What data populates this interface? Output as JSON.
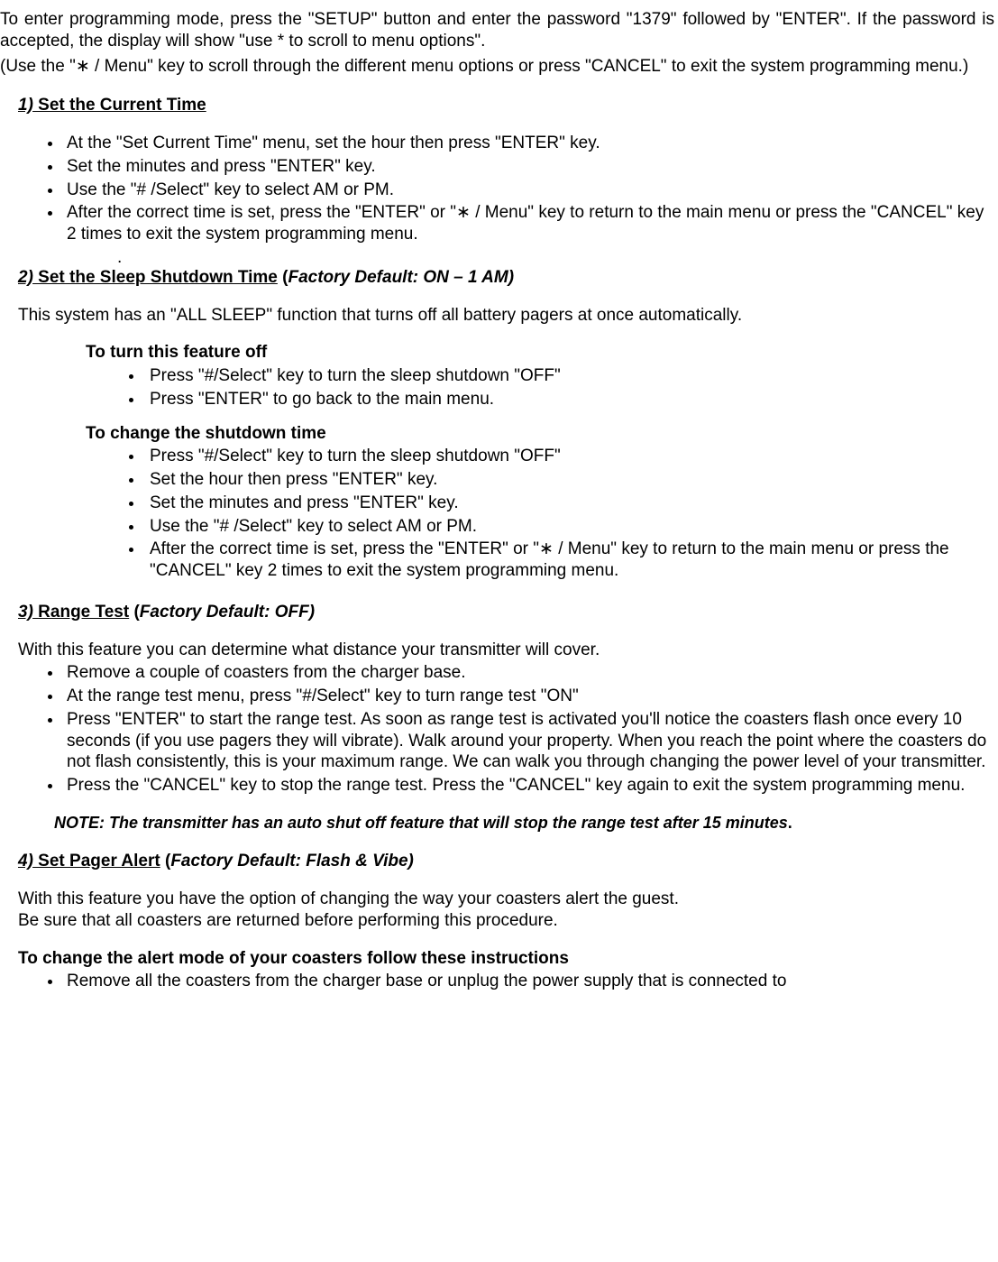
{
  "intro": "To enter programming mode, press the \"SETUP\" button and enter the password \"1379\" followed by \"ENTER\". If the password is accepted, the display will show \"use * to scroll to menu options\".",
  "intro2": "  (Use the \"∗ / Menu\" key to scroll through the different menu options or press \"CANCEL\" to exit the system programming menu.)",
  "s1": {
    "num": "1)",
    "title": " Set the Current Time",
    "items": [
      "At the \"Set Current Time\" menu, set the hour then press \"ENTER\" key.",
      "Set the minutes and press \"ENTER\" key.",
      "Use the \"# /Select\" key to select AM or PM.",
      "After the correct time is set, press the \"ENTER\" or \"∗ / Menu\" key to return to the main menu or press the \"CANCEL\" key 2 times to exit the system programming menu."
    ],
    "dot": "."
  },
  "s2": {
    "num": "2)",
    "title": " Set the Sleep Shutdown Time",
    "paren_open": " (",
    "default": "Factory Default: ON – 1 AM)",
    "desc": "This system has an \"ALL SLEEP\" function that turns off all battery pagers at once automatically.",
    "off_head": "To turn this feature off",
    "off_items": [
      "Press \"#/Select\" key to turn the sleep shutdown \"OFF\"",
      "Press \"ENTER\" to go back to the main menu."
    ],
    "change_head": "To change the shutdown time",
    "change_items": [
      "Press \"#/Select\" key to turn the sleep shutdown \"OFF\"",
      "Set the hour then press \"ENTER\" key.",
      "Set the minutes and press \"ENTER\" key.",
      "Use the \"# /Select\" key to select AM or PM.",
      "After the correct time is set, press the \"ENTER\" or \"∗ / Menu\" key to return to the main menu or press the \"CANCEL\" key 2 times to exit the system programming menu."
    ]
  },
  "s3": {
    "num": "3)",
    "title": " Range Test",
    "paren_open": " (",
    "default": "Factory Default: OFF)",
    "desc": "With this feature you can determine what distance your transmitter will cover.",
    "items": [
      "Remove a couple of coasters from the charger base.",
      "At the range test menu, press \"#/Select\" key to turn range test \"ON\"",
      "Press \"ENTER\" to start the range test. As soon as range test is activated you'll notice the coasters flash once every 10 seconds (if you use pagers they will vibrate). Walk around your property. When you reach the point where the coasters do not flash consistently, this is your maximum range. We can walk you through changing the power level of your transmitter.",
      "Press the \"CANCEL\" key to stop the range test. Press the \"CANCEL\" key again to exit the system programming menu."
    ],
    "note": "NOTE: The transmitter has an auto shut off feature that will stop the range test after 15 minutes",
    "note_tail": "."
  },
  "s4": {
    "num": "4)",
    "title": " Set Pager Alert",
    "paren_open": " (",
    "default": "Factory Default: Flash & Vibe)",
    "desc1": "With this feature you have the option of changing the way your coasters alert the guest.",
    "desc2": "Be sure that all coasters are returned before performing this procedure.",
    "change_head": "To change the alert mode of your coasters follow these instructions",
    "items": [
      "Remove all the coasters from the charger base or unplug the power supply that is connected to"
    ]
  }
}
